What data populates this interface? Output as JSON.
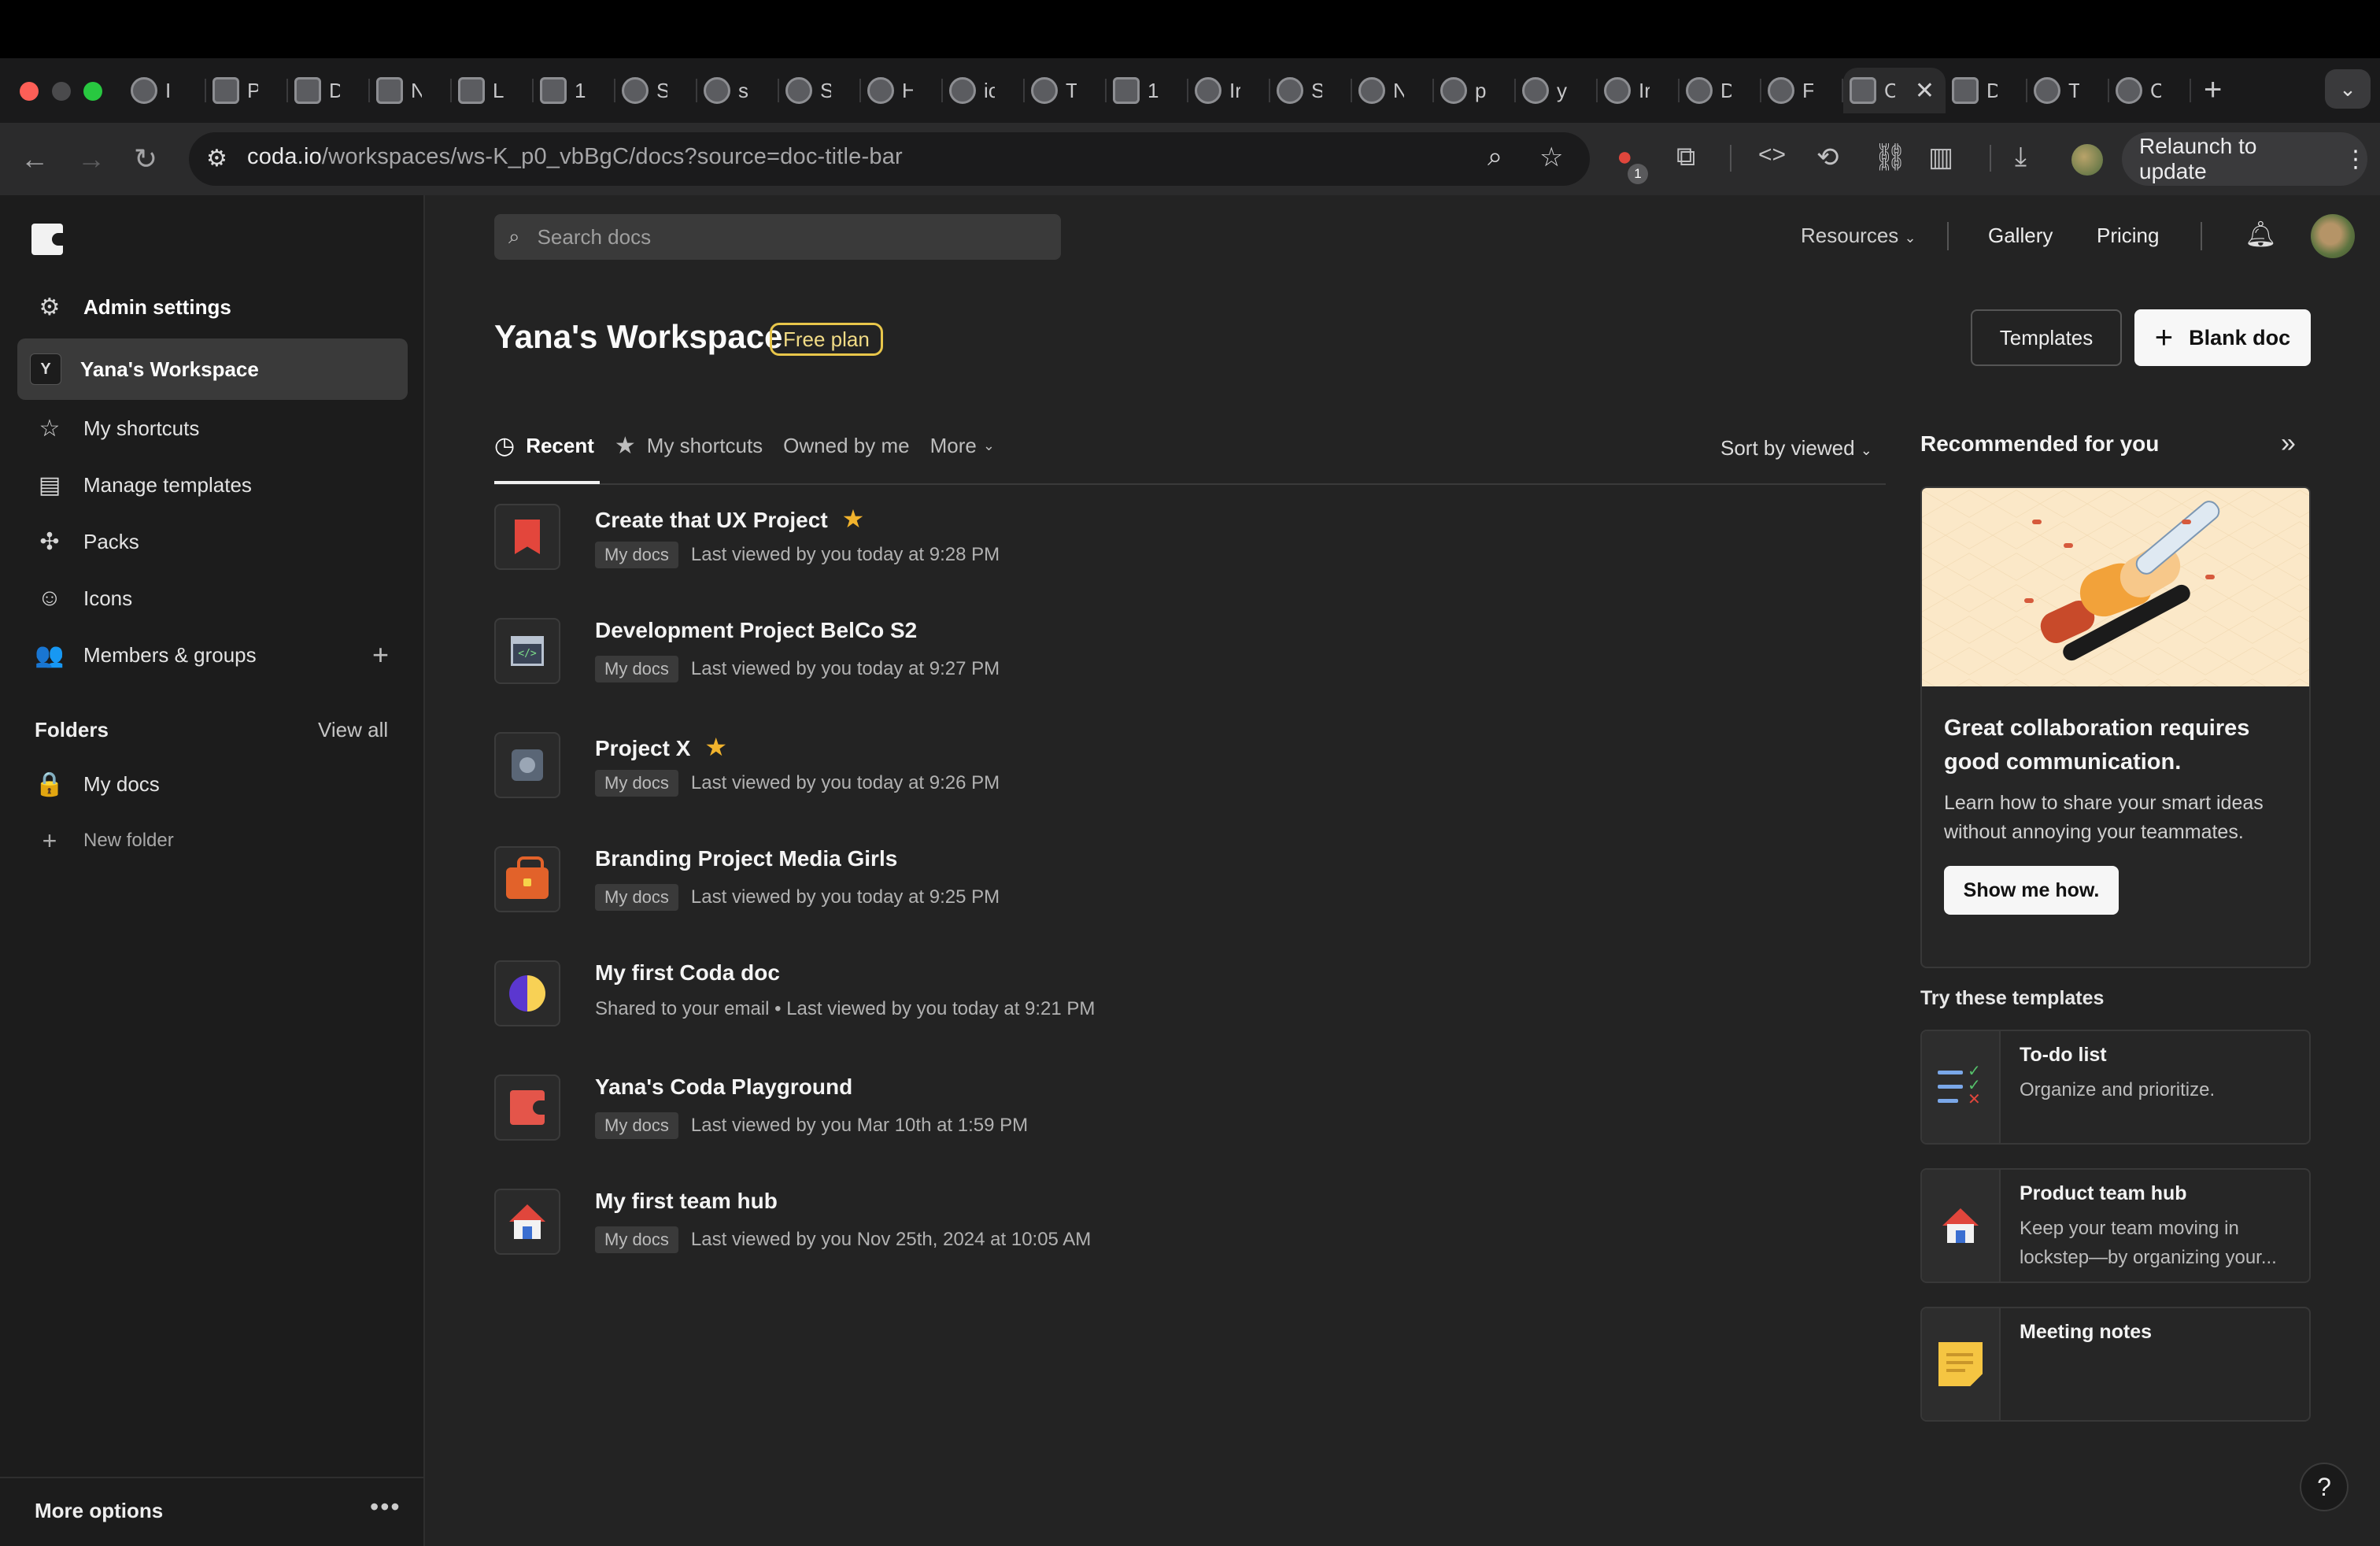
{
  "browser": {
    "tabs": [
      {
        "label": "I",
        "icon": "globe"
      },
      {
        "label": "P",
        "icon": "puzzle"
      },
      {
        "label": "D",
        "icon": "trello"
      },
      {
        "label": "N",
        "icon": "notion"
      },
      {
        "label": "L",
        "icon": "cube"
      },
      {
        "label": "1",
        "icon": "bars"
      },
      {
        "label": "S",
        "icon": "globe"
      },
      {
        "label": "s",
        "icon": "google"
      },
      {
        "label": "S",
        "icon": "globe"
      },
      {
        "label": "H",
        "icon": "half-circle"
      },
      {
        "label": "ic",
        "icon": "crown"
      },
      {
        "label": "T",
        "icon": "avatar"
      },
      {
        "label": "1",
        "icon": "ui"
      },
      {
        "label": "Ir",
        "icon": "wave"
      },
      {
        "label": "S",
        "icon": "color-wheel"
      },
      {
        "label": "N",
        "icon": "chrome"
      },
      {
        "label": "p",
        "icon": "triangle"
      },
      {
        "label": "y",
        "icon": "github"
      },
      {
        "label": "Ir",
        "icon": "wave"
      },
      {
        "label": "D",
        "icon": "slash"
      },
      {
        "label": "F",
        "icon": "globe"
      },
      {
        "label": "C",
        "icon": "coda",
        "active": true
      },
      {
        "label": "D",
        "icon": "download"
      },
      {
        "label": "T",
        "icon": "globe"
      },
      {
        "label": "C",
        "icon": "globe"
      }
    ],
    "url_host": "coda.io",
    "url_path": "/workspaces/ws-K_p0_vbBgC/docs?source=doc-title-bar",
    "extension_badge": "1",
    "relaunch_label": "Relaunch to update"
  },
  "sidebar": {
    "admin_settings": "Admin settings",
    "workspace_initial": "Y",
    "workspace_name": "Yana's Workspace",
    "items": [
      {
        "label": "My shortcuts",
        "icon": "star-icon"
      },
      {
        "label": "Manage templates",
        "icon": "template-icon"
      },
      {
        "label": "Packs",
        "icon": "puzzle-icon"
      },
      {
        "label": "Icons",
        "icon": "smiley-icon"
      },
      {
        "label": "Members & groups",
        "icon": "people-icon"
      }
    ],
    "folders_heading": "Folders",
    "view_all": "View all",
    "folder_my_docs": "My docs",
    "new_folder": "New folder",
    "more_options": "More options"
  },
  "header": {
    "search_placeholder": "Search docs",
    "resources": "Resources",
    "gallery": "Gallery",
    "pricing": "Pricing"
  },
  "workspace": {
    "title": "Yana's Workspace",
    "plan": "Free plan",
    "templates_button": "Templates",
    "blank_doc_button": "Blank doc"
  },
  "doc_tabs": {
    "recent": "Recent",
    "shortcuts": "My shortcuts",
    "owned": "Owned by me",
    "more": "More",
    "sort": "Sort by viewed"
  },
  "docs": [
    {
      "name": "Create that UX Project",
      "starred": true,
      "tag": "My docs",
      "meta": "Last viewed by you today at 9:28 PM",
      "icon": "bookmark"
    },
    {
      "name": "Development Project BelCo S2",
      "starred": false,
      "tag": "My docs",
      "meta": "Last viewed by you today at 9:27 PM",
      "icon": "code"
    },
    {
      "name": "Project X",
      "starred": true,
      "tag": "My docs",
      "meta": "Last viewed by you today at 9:26 PM",
      "icon": "camera"
    },
    {
      "name": "Branding Project Media Girls",
      "starred": false,
      "tag": "My docs",
      "meta": "Last viewed by you today at 9:25 PM",
      "icon": "bag"
    },
    {
      "name": "My first Coda doc",
      "starred": false,
      "tag": "",
      "meta": "Shared to your email • Last viewed by you today at 9:21 PM",
      "icon": "moon"
    },
    {
      "name": "Yana's Coda Playground",
      "starred": false,
      "tag": "My docs",
      "meta": "Last viewed by you Mar 10th at 1:59 PM",
      "icon": "coda"
    },
    {
      "name": "My first team hub",
      "starred": false,
      "tag": "My docs",
      "meta": "Last viewed by you Nov 25th, 2024 at 10:05 AM",
      "icon": "house"
    }
  ],
  "recommended": {
    "title": "Recommended for you",
    "heading": "Great collaboration requires good communication.",
    "body": "Learn how to share your smart ideas without annoying your teammates.",
    "button": "Show me how."
  },
  "templates": {
    "title": "Try these templates",
    "items": [
      {
        "name": "To-do list",
        "desc": "Organize and prioritize.",
        "icon": "todo-icon"
      },
      {
        "name": "Product team hub",
        "desc": "Keep your team moving in lockstep—by organizing your...",
        "icon": "house-icon"
      },
      {
        "name": "Meeting notes",
        "desc": "",
        "icon": "note-icon"
      }
    ]
  },
  "help": "?",
  "colors": {
    "accent_star": "#f1b32d",
    "plan_badge": "#e8c64a",
    "background": "#232323",
    "sidebar": "#1c1c1c"
  }
}
